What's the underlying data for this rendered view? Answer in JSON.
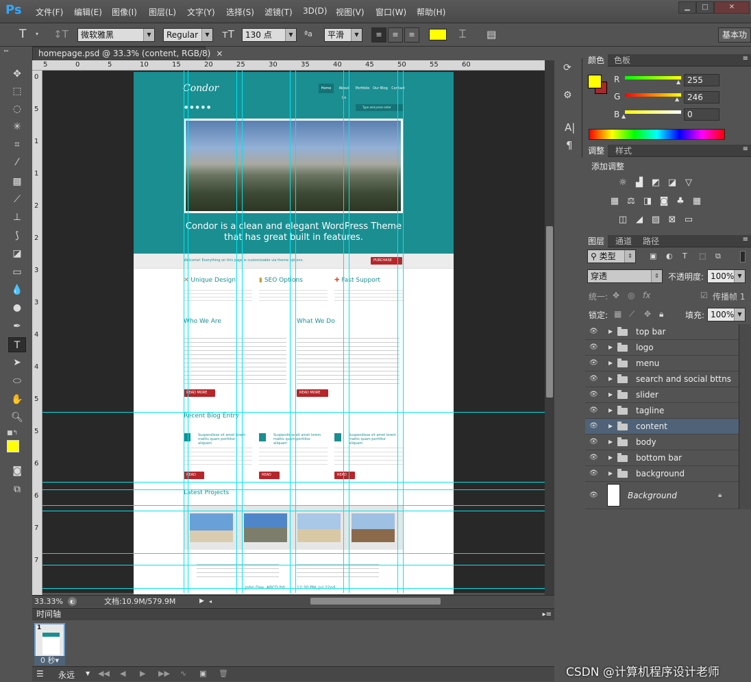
{
  "app": {
    "logo": "Ps"
  },
  "menu": [
    "文件(F)",
    "编辑(E)",
    "图像(I)",
    "图层(L)",
    "文字(Y)",
    "选择(S)",
    "滤镜(T)",
    "3D(D)",
    "视图(V)",
    "窗口(W)",
    "帮助(H)"
  ],
  "window_controls": {
    "minimize": "▁",
    "maximize": "□",
    "close": "✕"
  },
  "options": {
    "tool_glyph": "T",
    "font_family": "微软雅黑",
    "font_style": "Regular",
    "font_size": "130 点",
    "aa_label": "ªa",
    "antialias": "平滑",
    "workspace": "基本功",
    "text_color": "#ffff00"
  },
  "document": {
    "tab_title": "homepage.psd @ 33.3% (content, RGB/8)",
    "close": "×",
    "zoom": "33.33%",
    "doc_size": "文档:10.9M/579.9M",
    "ruler_h": [
      "5",
      "0",
      "5",
      "10",
      "15",
      "20",
      "25",
      "30",
      "35",
      "40",
      "45",
      "50",
      "55",
      "60"
    ],
    "ruler_v": [
      "0",
      "5",
      "1",
      "1",
      "2",
      "2",
      "3",
      "3",
      "4",
      "4",
      "5",
      "5",
      "6",
      "6",
      "7",
      "7"
    ]
  },
  "webpage": {
    "logo": "Condor",
    "nav": [
      "Home",
      "About Us",
      "Portfolio",
      "Our Blog",
      "Contact"
    ],
    "search_placeholder": "Type and press enter",
    "tagline_1": "Condor is a clean and elegant WordPress Theme",
    "tagline_2": "that has great built in features.",
    "welcome": "Welcome! Everything on this page is customizable via theme options.",
    "purchase": "PURCHASE",
    "features": [
      "Unique Design",
      "SEO Options",
      "Fast Support"
    ],
    "who_we_are": "Who We Are",
    "what_we_do": "What We Do",
    "read_more": "READ MORE",
    "recent_blog": "Recent Blog Entry",
    "blog_title": "Suspendisse sit amet lorem mattis quam porttitor aliquam",
    "latest_projects": "Latest Projects",
    "testimonial_author": "John Doe, ABCD ltd",
    "testimonial_time": "12:30 PM, Jul 22nd"
  },
  "timeline": {
    "title": "时间轴",
    "frame_num": "1",
    "frame_time": "0 秒▾",
    "loop": "永远"
  },
  "color_panel": {
    "tabs": [
      "颜色",
      "色板"
    ],
    "r_label": "R",
    "r": "255",
    "g_label": "G",
    "g": "246",
    "b_label": "B",
    "b": "0",
    "fg": "#ffff00",
    "bg": "#a52a2a"
  },
  "adjust_panel": {
    "tabs": [
      "调整",
      "样式"
    ],
    "title": "添加调整"
  },
  "layers_panel": {
    "tabs": [
      "图层",
      "通道",
      "路径"
    ],
    "kind": "类型",
    "blend": "穿透",
    "opacity_label": "不透明度:",
    "opacity": "100%",
    "unify_label": "统一:",
    "propagate": "传播帧 1",
    "lock_label": "锁定:",
    "fill_label": "填充:",
    "fill": "100%",
    "layers": [
      "top bar",
      "logo",
      "menu",
      "search and social bttns",
      "slider",
      "tagline",
      "content",
      "body",
      "bottom bar",
      "background"
    ],
    "selected": "content",
    "background_layer": "Background"
  },
  "watermark": "CSDN @计算机程序设计老师"
}
